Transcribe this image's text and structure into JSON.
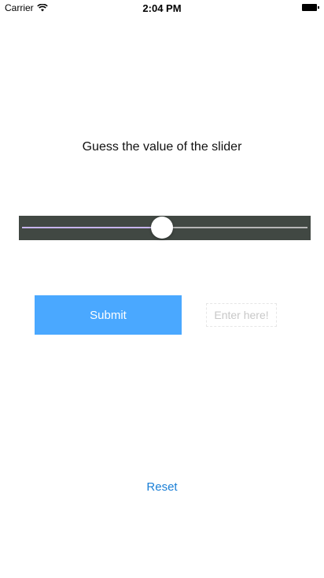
{
  "status_bar": {
    "carrier": "Carrier",
    "time": "2:04 PM",
    "icons": [
      "wifi-icon",
      "battery-icon"
    ]
  },
  "prompt": {
    "text": "Guess the value of the slider"
  },
  "slider": {
    "value_fraction": 0.49,
    "minimum_track_color": "#c7b4ec",
    "maximum_track_color": "#b6b6b6",
    "background_color": "#414843",
    "thumb_color": "#ffffff"
  },
  "submit_button": {
    "label": "Submit",
    "color": "#4aa8ff"
  },
  "guess_input": {
    "value": "",
    "placeholder": "Enter here!"
  },
  "reset": {
    "label": "Reset",
    "color": "#1a7fd6"
  }
}
